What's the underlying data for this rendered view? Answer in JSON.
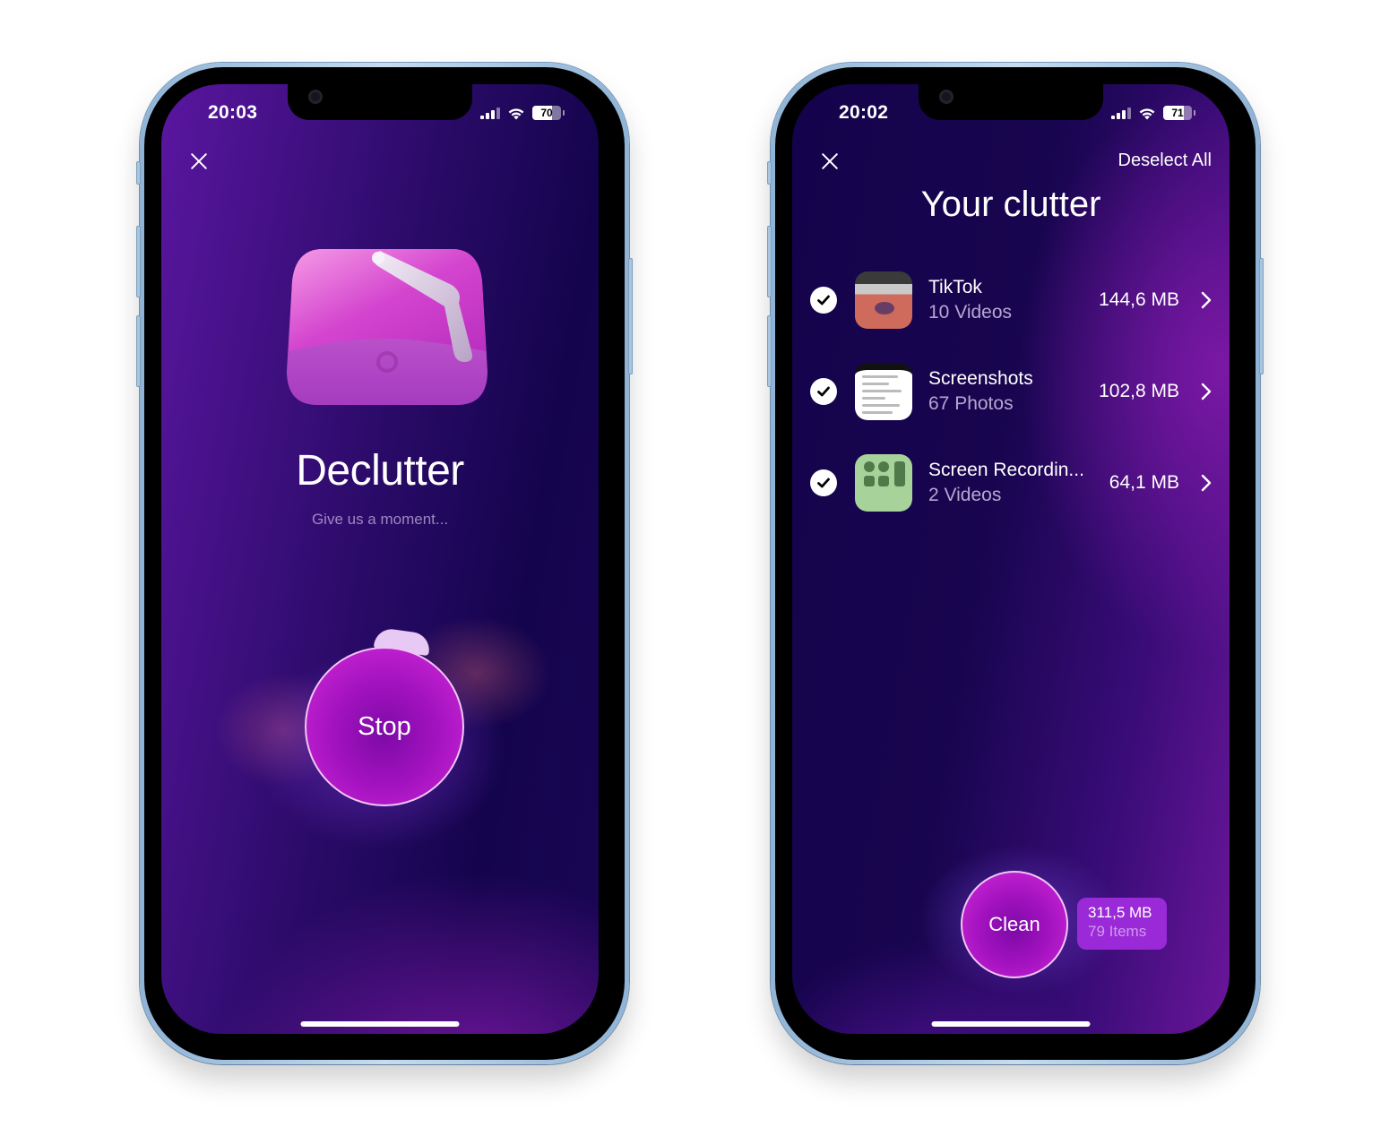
{
  "left_phone": {
    "status_bar": {
      "time": "20:03",
      "battery_percent": 70,
      "battery_label": "70",
      "icons": [
        "cellular-signal-icon",
        "wifi-icon",
        "battery-icon"
      ]
    },
    "close_icon": "close-icon",
    "app_icon": "declutter-box-icon",
    "title": "Declutter",
    "subtitle": "Give us a moment...",
    "stop_button": "Stop"
  },
  "right_phone": {
    "status_bar": {
      "time": "20:02",
      "battery_percent": 71,
      "battery_label": "71",
      "icons": [
        "cellular-signal-icon",
        "wifi-icon",
        "battery-icon"
      ]
    },
    "close_icon": "close-icon",
    "deselect_all": "Deselect All",
    "title": "Your clutter",
    "items": [
      {
        "name": "TikTok",
        "count": "10 Videos",
        "size": "144,6 MB",
        "selected": true
      },
      {
        "name": "Screenshots",
        "count": "67 Photos",
        "size": "102,8 MB",
        "selected": true
      },
      {
        "name": "Screen Recordin...",
        "count": "2 Videos",
        "size": "64,1 MB",
        "selected": true
      }
    ],
    "clean_button": "Clean",
    "total": {
      "size": "311,5 MB",
      "items": "79 Items"
    }
  },
  "colors": {
    "accent_magenta": "#d42ad8",
    "badge_purple": "#9a2ad8",
    "background_dark": "#14044d",
    "background_purple": "#7d18a6",
    "frame_blue": "#a9c6e1"
  }
}
